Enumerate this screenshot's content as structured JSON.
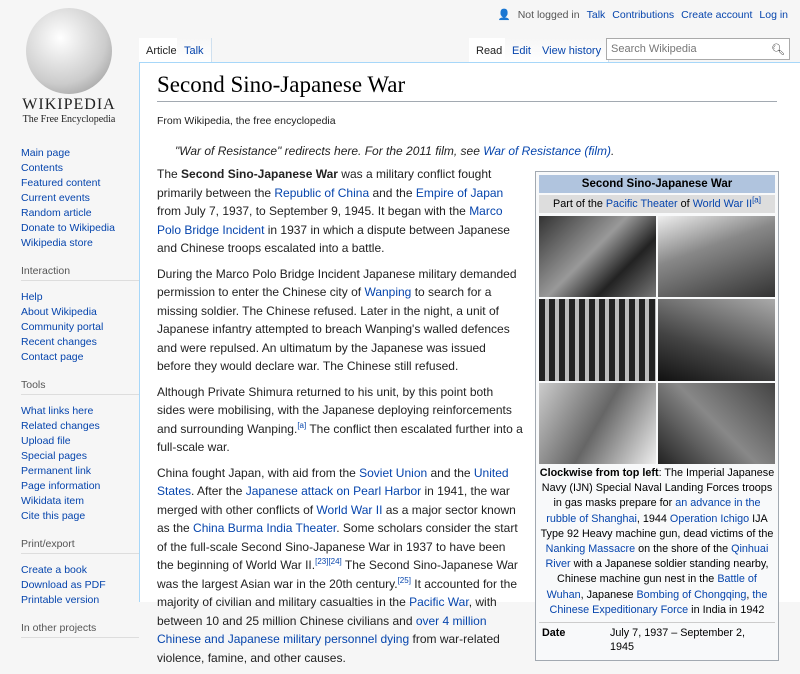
{
  "logo": {
    "wordmark": "Wikipedia",
    "tagline": "The Free Encyclopedia"
  },
  "personal": {
    "status": "Not logged in",
    "links": [
      "Talk",
      "Contributions",
      "Create account",
      "Log in"
    ]
  },
  "tabs": {
    "left": [
      "Article",
      "Talk"
    ],
    "right": [
      "Read",
      "Edit",
      "View history"
    ]
  },
  "search": {
    "placeholder": "Search Wikipedia"
  },
  "sidebar": {
    "nav": [
      "Main page",
      "Contents",
      "Featured content",
      "Current events",
      "Random article",
      "Donate to Wikipedia",
      "Wikipedia store"
    ],
    "interaction": {
      "title": "Interaction",
      "items": [
        "Help",
        "About Wikipedia",
        "Community portal",
        "Recent changes",
        "Contact page"
      ]
    },
    "tools": {
      "title": "Tools",
      "items": [
        "What links here",
        "Related changes",
        "Upload file",
        "Special pages",
        "Permanent link",
        "Page information",
        "Wikidata item",
        "Cite this page"
      ]
    },
    "print": {
      "title": "Print/export",
      "items": [
        "Create a book",
        "Download as PDF",
        "Printable version"
      ]
    },
    "other": {
      "title": "In other projects"
    }
  },
  "article": {
    "title": "Second Sino-Japanese War",
    "from": "From Wikipedia, the free encyclopedia",
    "hatnote": [
      {
        "t": "\"War of Resistance\" redirects here. For the 2011 film, see "
      },
      {
        "t": "War of Resistance (film)",
        "l": 1
      },
      {
        "t": "."
      }
    ],
    "paragraphs": [
      [
        {
          "t": "The "
        },
        {
          "t": "Second Sino-Japanese War",
          "b": 1
        },
        {
          "t": " was a military conflict fought primarily between the "
        },
        {
          "t": "Republic of China",
          "l": 1
        },
        {
          "t": " and the "
        },
        {
          "t": "Empire of Japan",
          "l": 1
        },
        {
          "t": " from July 7, 1937, to September 9, 1945. It began with the "
        },
        {
          "t": "Marco Polo Bridge Incident",
          "l": 1
        },
        {
          "t": " in 1937 in which a dispute between Japanese and Chinese troops escalated into a battle."
        }
      ],
      [
        {
          "t": "During the Marco Polo Bridge Incident Japanese military demanded permission to enter the Chinese city of "
        },
        {
          "t": "Wanping",
          "l": 1
        },
        {
          "t": " to search for a missing soldier. The Chinese refused. Later in the night, a unit of Japanese infantry attempted to breach Wanping's walled defences and were repulsed. An ultimatum by the Japanese was issued before they would declare war. The Chinese still refused."
        }
      ],
      [
        {
          "t": "Although Private Shimura returned to his unit, by this point both sides were mobilising, with the Japanese deploying reinforcements and surrounding Wanping."
        },
        {
          "t": "[a]",
          "s": 1
        },
        {
          "t": " The conflict then escalated further into a full-scale war."
        }
      ],
      [
        {
          "t": "China fought Japan, with aid from the "
        },
        {
          "t": "Soviet Union",
          "l": 1
        },
        {
          "t": " and the "
        },
        {
          "t": "United States",
          "l": 1
        },
        {
          "t": ". After the "
        },
        {
          "t": "Japanese attack on Pearl Harbor",
          "l": 1
        },
        {
          "t": " in 1941, the war merged with other conflicts of "
        },
        {
          "t": "World War II",
          "l": 1
        },
        {
          "t": " as a major sector known as the "
        },
        {
          "t": "China Burma India Theater",
          "l": 1
        },
        {
          "t": ". Some scholars consider the start of the full-scale Second Sino-Japanese War in 1937 to have been the beginning of World War II."
        },
        {
          "t": "[23][24]",
          "s": 1
        },
        {
          "t": " The Second Sino-Japanese War was the largest Asian war in the 20th century."
        },
        {
          "t": "[25]",
          "s": 1
        },
        {
          "t": " It accounted for the majority of civilian and military casualties in the "
        },
        {
          "t": "Pacific War",
          "l": 1
        },
        {
          "t": ", with between 10 and 25 million Chinese civilians and "
        },
        {
          "t": "over 4 million Chinese and Japanese military personnel dying",
          "l": 1
        },
        {
          "t": " from war-related violence, famine, and other causes."
        }
      ]
    ]
  },
  "infobox": {
    "title": "Second Sino-Japanese War",
    "subtitle": [
      {
        "t": "Part of the "
      },
      {
        "t": "Pacific Theater",
        "l": 1
      },
      {
        "t": " of "
      },
      {
        "t": "World War II",
        "l": 1
      },
      {
        "t": "[a]",
        "s": 1
      }
    ],
    "caption": [
      {
        "t": "Clockwise from top left",
        "b": 1
      },
      {
        "t": ": The Imperial Japanese Navy (IJN) Special Naval Landing Forces troops in gas masks prepare for "
      },
      {
        "t": "an advance in the rubble of Shanghai",
        "l": 1
      },
      {
        "t": ", 1944 "
      },
      {
        "t": "Operation Ichigo",
        "l": 1
      },
      {
        "t": " IJA Type 92 Heavy machine gun, dead victims of the "
      },
      {
        "t": "Nanking Massacre",
        "l": 1
      },
      {
        "t": " on the shore of the "
      },
      {
        "t": "Qinhuai River",
        "l": 1
      },
      {
        "t": " with a Japanese soldier standing nearby, Chinese machine gun nest in the "
      },
      {
        "t": "Battle of Wuhan",
        "l": 1
      },
      {
        "t": ", Japanese "
      },
      {
        "t": "Bombing of Chongqing",
        "l": 1
      },
      {
        "t": ", "
      },
      {
        "t": "the Chinese Expeditionary Force",
        "l": 1
      },
      {
        "t": " in India in 1942"
      }
    ],
    "date_label": "Date",
    "date_value": "July 7, 1937 – September 2, 1945"
  }
}
